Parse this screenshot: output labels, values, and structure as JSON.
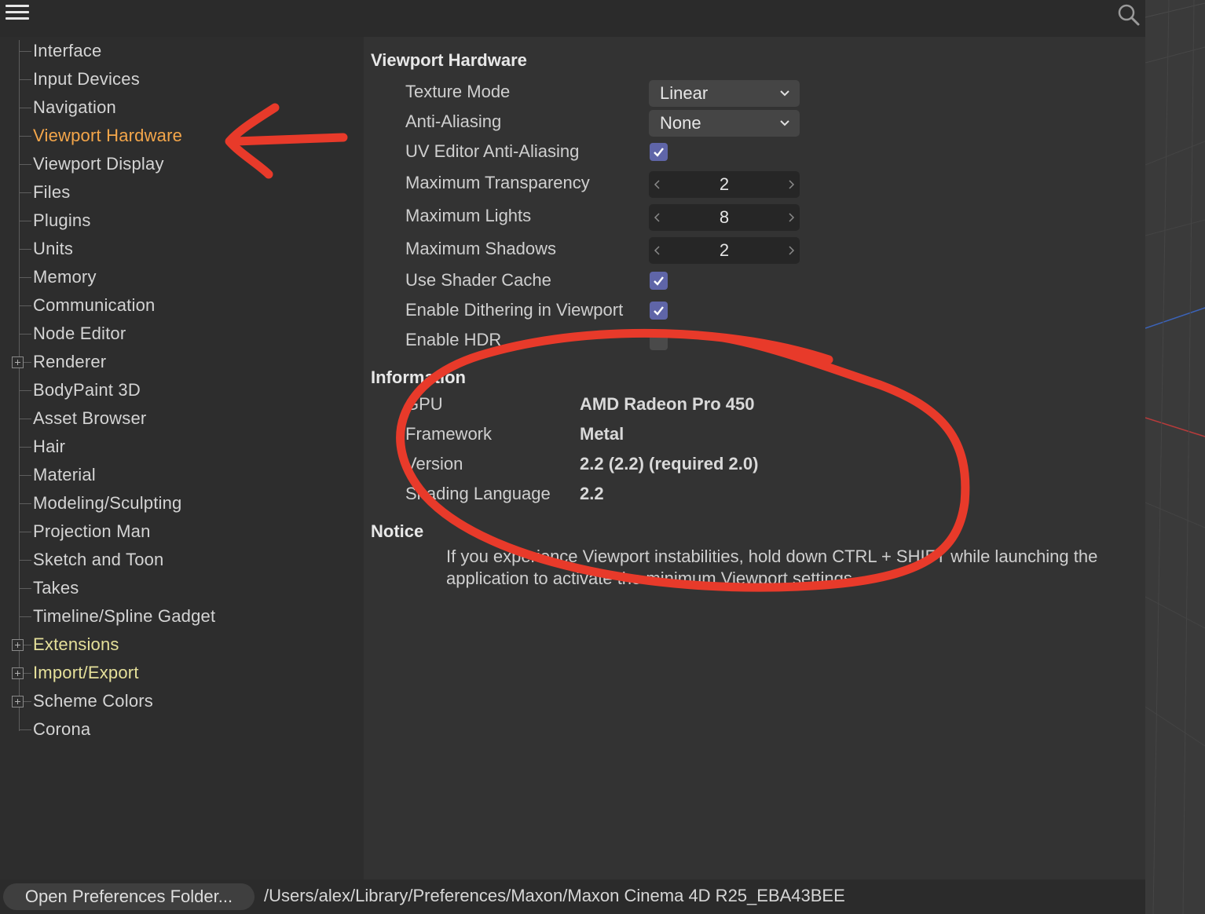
{
  "toolbar": {
    "menu_icon": "hamburger-menu-icon",
    "search_icon": "search-icon"
  },
  "sidebar": {
    "items": [
      {
        "label": "Interface"
      },
      {
        "label": "Input Devices"
      },
      {
        "label": "Navigation"
      },
      {
        "label": "Viewport Hardware",
        "active": true
      },
      {
        "label": "Viewport Display"
      },
      {
        "label": "Files"
      },
      {
        "label": "Plugins"
      },
      {
        "label": "Units"
      },
      {
        "label": "Memory"
      },
      {
        "label": "Communication"
      },
      {
        "label": "Node Editor"
      },
      {
        "label": "Renderer",
        "expandable": true
      },
      {
        "label": "BodyPaint 3D"
      },
      {
        "label": "Asset Browser"
      },
      {
        "label": "Hair"
      },
      {
        "label": "Material"
      },
      {
        "label": "Modeling/Sculpting"
      },
      {
        "label": "Projection Man"
      },
      {
        "label": "Sketch and Toon"
      },
      {
        "label": "Takes"
      },
      {
        "label": "Timeline/Spline Gadget"
      },
      {
        "label": "Extensions",
        "expandable": true
      },
      {
        "label": "Import/Export",
        "expandable": true
      },
      {
        "label": "Scheme Colors",
        "expandable": true
      },
      {
        "label": "Corona"
      }
    ]
  },
  "main": {
    "title": "Viewport Hardware",
    "settings": {
      "texture_mode": {
        "label": "Texture Mode",
        "value": "Linear"
      },
      "anti_aliasing": {
        "label": "Anti-Aliasing",
        "value": "None"
      },
      "uv_editor_aa": {
        "label": "UV Editor Anti-Aliasing",
        "checked": true
      },
      "max_transparency": {
        "label": "Maximum Transparency",
        "value": "2"
      },
      "max_lights": {
        "label": "Maximum Lights",
        "value": "8"
      },
      "max_shadows": {
        "label": "Maximum Shadows",
        "value": "2"
      },
      "use_shader_cache": {
        "label": "Use Shader Cache",
        "checked": true
      },
      "enable_dithering": {
        "label": "Enable Dithering in Viewport",
        "checked": true
      },
      "enable_hdr": {
        "label": "Enable HDR",
        "checked": false
      }
    },
    "information": {
      "title": "Information",
      "rows": [
        {
          "label": "GPU",
          "value": "AMD Radeon Pro 450"
        },
        {
          "label": "Framework",
          "value": "Metal"
        },
        {
          "label": "Version",
          "value": "2.2 (2.2) (required 2.0)"
        },
        {
          "label": "Shading Language",
          "value": "2.2"
        }
      ]
    },
    "notice": {
      "title": "Notice",
      "text": "If you experience Viewport instabilities, hold down CTRL + SHIFT while launching the application to activate the minimum Viewport settings."
    }
  },
  "footer": {
    "open_folder_label": "Open Preferences Folder...",
    "path": "/Users/alex/Library/Preferences/Maxon/Maxon Cinema 4D R25_EBA43BEE"
  },
  "colors": {
    "active_item": "#f4a64a",
    "yellow_item": "#e5e09a",
    "checkbox": "#5f65a8",
    "annotation": "#e83a2a"
  }
}
